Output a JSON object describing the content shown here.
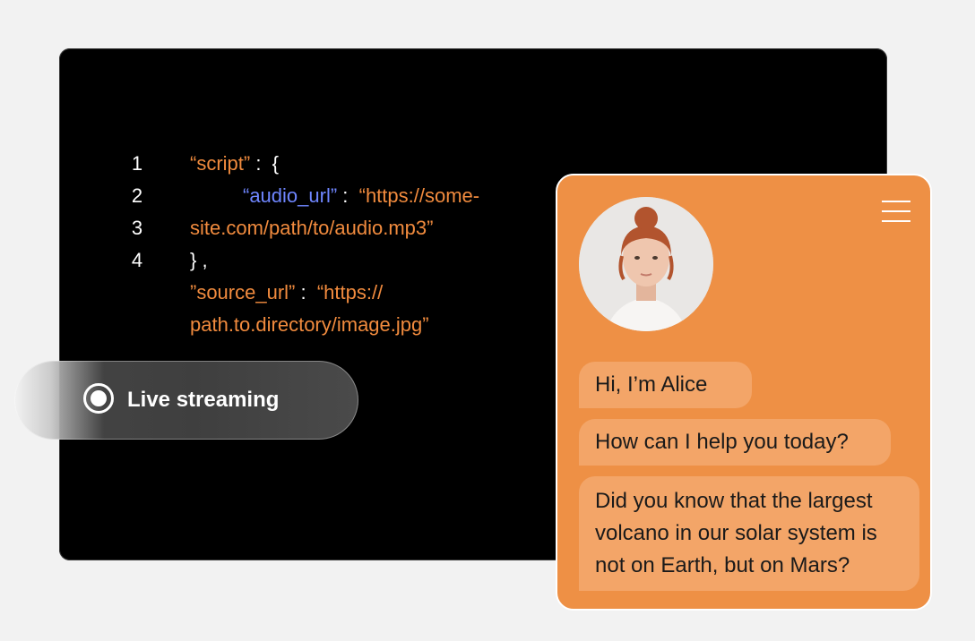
{
  "code_editor": {
    "line_numbers": [
      "1",
      "2",
      "3",
      "4"
    ],
    "lines": {
      "l1_key": "“script”",
      "l1_rest": " :  {",
      "l2_key": "“audio_url”",
      "l2_colon": " :  ",
      "l2_val": "“https://some-",
      "l3": "site.com/path/to/audio.mp3”",
      "l4": "} ,",
      "l5_key": "”source_url”",
      "l5_colon": " :  ",
      "l5_val": "“https://",
      "l6": "path.to.directory/image.jpg”"
    }
  },
  "live_streaming": {
    "label": "Live streaming",
    "icon": "record-icon"
  },
  "chat": {
    "menu_icon": "hamburger-menu-icon",
    "messages": [
      "Hi, I’m Alice",
      "How can I help you today?",
      "Did you know that the largest volcano in our solar system is not on Earth, but on Mars?"
    ]
  },
  "colors": {
    "background": "#f2f2f2",
    "editor_bg": "#000000",
    "code_orange": "#f18b3e",
    "code_blue": "#6f86ff",
    "chat_bg": "#ee9045",
    "bubble_bg": "#f3a568"
  }
}
